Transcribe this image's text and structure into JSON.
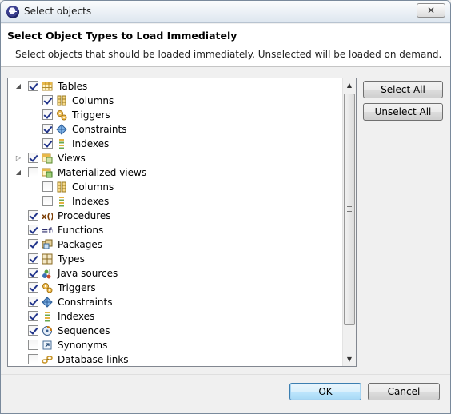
{
  "window": {
    "title": "Select objects",
    "close_label": "✕"
  },
  "header": {
    "title": "Select Object Types to Load Immediately",
    "description": "Select objects that should be loaded immediately. Unselected will be loaded on demand."
  },
  "tree": {
    "items": [
      {
        "label": "Tables",
        "checked": true,
        "expander": "expanded",
        "level": 0,
        "icon": "tables-icon"
      },
      {
        "label": "Columns",
        "checked": true,
        "expander": "none",
        "level": 1,
        "icon": "columns-icon"
      },
      {
        "label": "Triggers",
        "checked": true,
        "expander": "none",
        "level": 1,
        "icon": "triggers-icon"
      },
      {
        "label": "Constraints",
        "checked": true,
        "expander": "none",
        "level": 1,
        "icon": "constraints-icon"
      },
      {
        "label": "Indexes",
        "checked": true,
        "expander": "none",
        "level": 1,
        "icon": "indexes-icon"
      },
      {
        "label": "Views",
        "checked": true,
        "expander": "collapsed",
        "level": 0,
        "icon": "views-icon"
      },
      {
        "label": "Materialized views",
        "checked": false,
        "expander": "expanded",
        "level": 0,
        "icon": "materialized-views-icon"
      },
      {
        "label": "Columns",
        "checked": false,
        "expander": "none",
        "level": 1,
        "icon": "columns-icon"
      },
      {
        "label": "Indexes",
        "checked": false,
        "expander": "none",
        "level": 1,
        "icon": "indexes-icon"
      },
      {
        "label": "Procedures",
        "checked": true,
        "expander": "none",
        "level": 0,
        "icon": "procedures-icon"
      },
      {
        "label": "Functions",
        "checked": true,
        "expander": "none",
        "level": 0,
        "icon": "functions-icon"
      },
      {
        "label": "Packages",
        "checked": true,
        "expander": "none",
        "level": 0,
        "icon": "packages-icon"
      },
      {
        "label": "Types",
        "checked": true,
        "expander": "none",
        "level": 0,
        "icon": "types-icon"
      },
      {
        "label": "Java sources",
        "checked": true,
        "expander": "none",
        "level": 0,
        "icon": "java-sources-icon"
      },
      {
        "label": "Triggers",
        "checked": true,
        "expander": "none",
        "level": 0,
        "icon": "triggers-icon"
      },
      {
        "label": "Constraints",
        "checked": true,
        "expander": "none",
        "level": 0,
        "icon": "constraints-icon"
      },
      {
        "label": "Indexes",
        "checked": true,
        "expander": "none",
        "level": 0,
        "icon": "indexes-icon"
      },
      {
        "label": "Sequences",
        "checked": true,
        "expander": "none",
        "level": 0,
        "icon": "sequences-icon"
      },
      {
        "label": "Synonyms",
        "checked": false,
        "expander": "none",
        "level": 0,
        "icon": "synonyms-icon"
      },
      {
        "label": "Database links",
        "checked": false,
        "expander": "none",
        "level": 0,
        "icon": "database-links-icon"
      }
    ]
  },
  "buttons": {
    "select_all": "Select All",
    "unselect_all": "Unselect All",
    "ok": "OK",
    "cancel": "Cancel"
  },
  "icons": {
    "expanded": "◢",
    "collapsed": "▷",
    "scroll_up": "▲",
    "scroll_down": "▼"
  },
  "colors": {
    "accent": "#21348b",
    "default_button_border": "#3c7fb1"
  }
}
